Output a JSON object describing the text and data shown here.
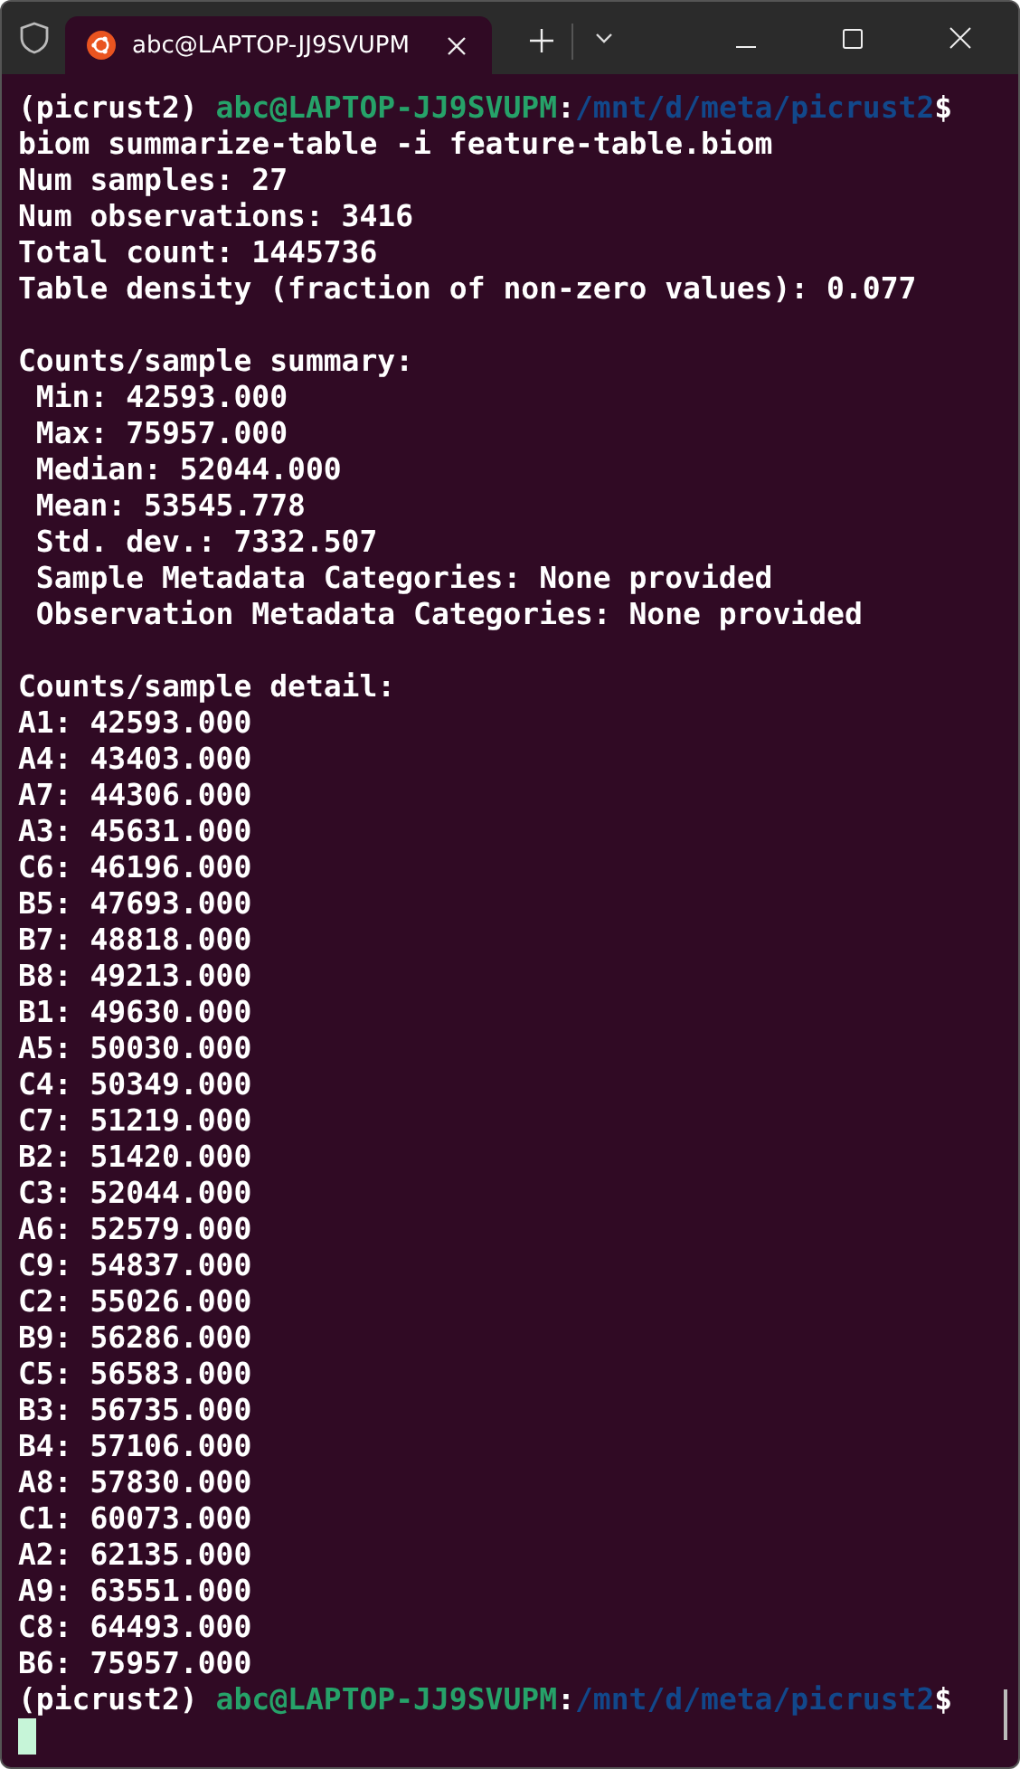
{
  "window": {
    "tab": {
      "title": "abc@LAPTOP-JJ9SVUPM",
      "selected": true
    }
  },
  "terminal": {
    "lines": [
      {
        "kind": "prompt",
        "env": "(picrust2) ",
        "user_host": "abc@LAPTOP-JJ9SVUPM",
        "sep": ":",
        "path": "/mnt/d/meta/picrust2",
        "symbol": "$"
      },
      {
        "kind": "text",
        "text": "biom summarize-table -i feature-table.biom"
      },
      {
        "kind": "text",
        "text": "Num samples: 27"
      },
      {
        "kind": "text",
        "text": "Num observations: 3416"
      },
      {
        "kind": "text",
        "text": "Total count: 1445736"
      },
      {
        "kind": "text",
        "text": "Table density (fraction of non-zero values): 0.077"
      },
      {
        "kind": "blank"
      },
      {
        "kind": "text",
        "text": "Counts/sample summary:"
      },
      {
        "kind": "text",
        "text": " Min: 42593.000"
      },
      {
        "kind": "text",
        "text": " Max: 75957.000"
      },
      {
        "kind": "text",
        "text": " Median: 52044.000"
      },
      {
        "kind": "text",
        "text": " Mean: 53545.778"
      },
      {
        "kind": "text",
        "text": " Std. dev.: 7332.507"
      },
      {
        "kind": "text",
        "text": " Sample Metadata Categories: None provided"
      },
      {
        "kind": "text",
        "text": " Observation Metadata Categories: None provided"
      },
      {
        "kind": "blank"
      },
      {
        "kind": "text",
        "text": "Counts/sample detail:"
      },
      {
        "kind": "text",
        "text": "A1: 42593.000"
      },
      {
        "kind": "text",
        "text": "A4: 43403.000"
      },
      {
        "kind": "text",
        "text": "A7: 44306.000"
      },
      {
        "kind": "text",
        "text": "A3: 45631.000"
      },
      {
        "kind": "text",
        "text": "C6: 46196.000"
      },
      {
        "kind": "text",
        "text": "B5: 47693.000"
      },
      {
        "kind": "text",
        "text": "B7: 48818.000"
      },
      {
        "kind": "text",
        "text": "B8: 49213.000"
      },
      {
        "kind": "text",
        "text": "B1: 49630.000"
      },
      {
        "kind": "text",
        "text": "A5: 50030.000"
      },
      {
        "kind": "text",
        "text": "C4: 50349.000"
      },
      {
        "kind": "text",
        "text": "C7: 51219.000"
      },
      {
        "kind": "text",
        "text": "B2: 51420.000"
      },
      {
        "kind": "text",
        "text": "C3: 52044.000"
      },
      {
        "kind": "text",
        "text": "A6: 52579.000"
      },
      {
        "kind": "text",
        "text": "C9: 54837.000"
      },
      {
        "kind": "text",
        "text": "C2: 55026.000"
      },
      {
        "kind": "text",
        "text": "B9: 56286.000"
      },
      {
        "kind": "text",
        "text": "C5: 56583.000"
      },
      {
        "kind": "text",
        "text": "B3: 56735.000"
      },
      {
        "kind": "text",
        "text": "B4: 57106.000"
      },
      {
        "kind": "text",
        "text": "A8: 57830.000"
      },
      {
        "kind": "text",
        "text": "C1: 60073.000"
      },
      {
        "kind": "text",
        "text": "A2: 62135.000"
      },
      {
        "kind": "text",
        "text": "A9: 63551.000"
      },
      {
        "kind": "text",
        "text": "C8: 64493.000"
      },
      {
        "kind": "text",
        "text": "B6: 75957.000"
      },
      {
        "kind": "prompt",
        "env": "(picrust2) ",
        "user_host": "abc@LAPTOP-JJ9SVUPM",
        "sep": ":",
        "path": "/mnt/d/meta/picrust2",
        "symbol": "$"
      },
      {
        "kind": "cursor"
      }
    ]
  }
}
